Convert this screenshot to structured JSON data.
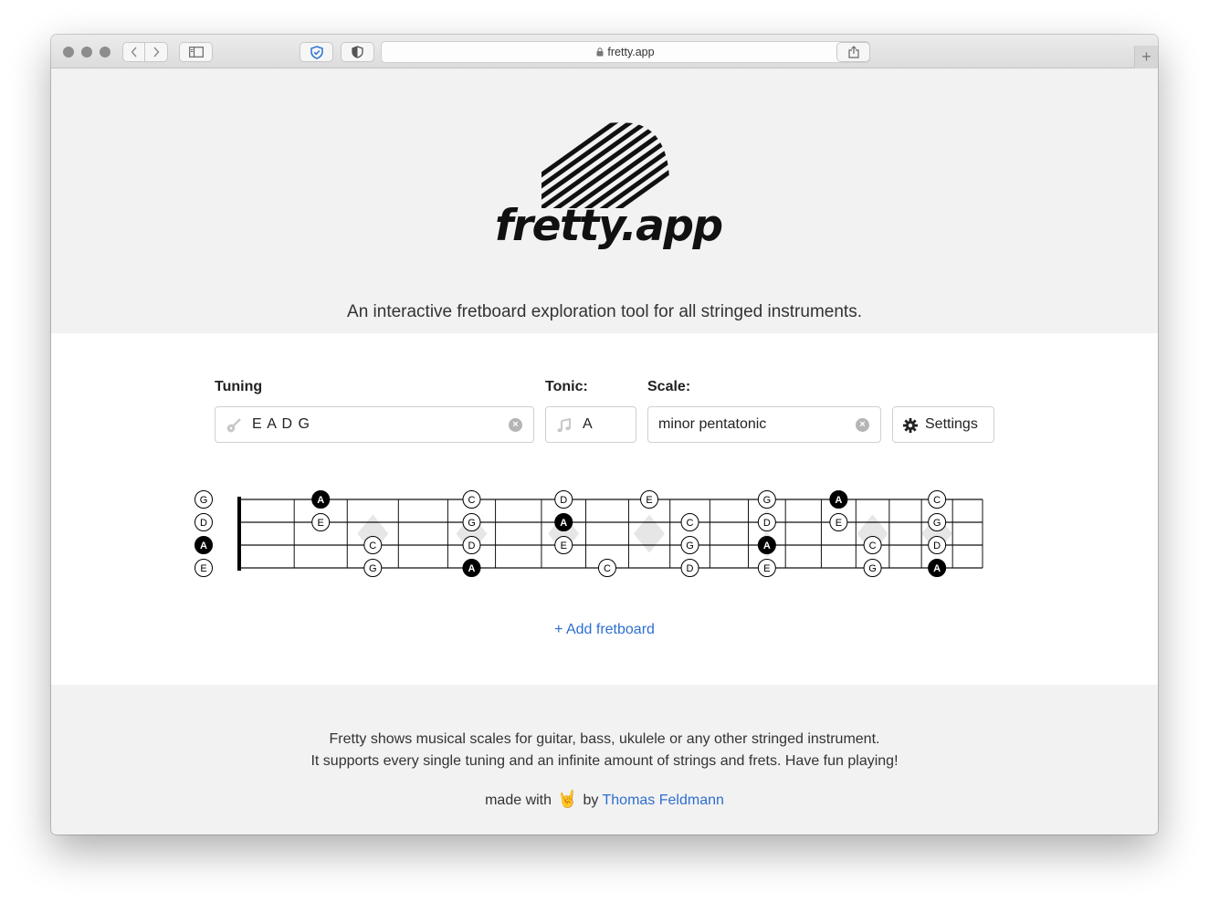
{
  "browser": {
    "url": "fretty.app"
  },
  "hero": {
    "logo_text": "fretty.app",
    "tagline": "An interactive fretboard exploration tool for all stringed instruments."
  },
  "controls": {
    "tuning_label": "Tuning",
    "tuning_value": "E A D G",
    "tonic_label": "Tonic:",
    "tonic_value": "A",
    "scale_label": "Scale:",
    "scale_value": "minor pentatonic",
    "settings_label": "Settings"
  },
  "fretboard": {
    "open_strings": [
      "G",
      "D",
      "A",
      "E"
    ],
    "tonic": "A",
    "notes": [
      {
        "string": 0,
        "fret": 2,
        "note": "A"
      },
      {
        "string": 0,
        "fret": 5,
        "note": "C"
      },
      {
        "string": 0,
        "fret": 7,
        "note": "D"
      },
      {
        "string": 0,
        "fret": 9,
        "note": "E"
      },
      {
        "string": 0,
        "fret": 12,
        "note": "G"
      },
      {
        "string": 0,
        "fret": 14,
        "note": "A"
      },
      {
        "string": 0,
        "fret": 17,
        "note": "C"
      },
      {
        "string": 1,
        "fret": 2,
        "note": "E"
      },
      {
        "string": 1,
        "fret": 5,
        "note": "G"
      },
      {
        "string": 1,
        "fret": 7,
        "note": "A"
      },
      {
        "string": 1,
        "fret": 10,
        "note": "C"
      },
      {
        "string": 1,
        "fret": 12,
        "note": "D"
      },
      {
        "string": 1,
        "fret": 14,
        "note": "E"
      },
      {
        "string": 1,
        "fret": 17,
        "note": "G"
      },
      {
        "string": 2,
        "fret": 3,
        "note": "C"
      },
      {
        "string": 2,
        "fret": 5,
        "note": "D"
      },
      {
        "string": 2,
        "fret": 7,
        "note": "E"
      },
      {
        "string": 2,
        "fret": 10,
        "note": "G"
      },
      {
        "string": 2,
        "fret": 12,
        "note": "A"
      },
      {
        "string": 2,
        "fret": 15,
        "note": "C"
      },
      {
        "string": 2,
        "fret": 17,
        "note": "D"
      },
      {
        "string": 3,
        "fret": 3,
        "note": "G"
      },
      {
        "string": 3,
        "fret": 5,
        "note": "A"
      },
      {
        "string": 3,
        "fret": 8,
        "note": "C"
      },
      {
        "string": 3,
        "fret": 10,
        "note": "D"
      },
      {
        "string": 3,
        "fret": 12,
        "note": "E"
      },
      {
        "string": 3,
        "fret": 15,
        "note": "G"
      },
      {
        "string": 3,
        "fret": 17,
        "note": "A"
      }
    ]
  },
  "add_fretboard_label": "+ Add fretboard",
  "footer": {
    "line1": "Fretty shows musical scales for guitar, bass, ukulele or any other stringed instrument.",
    "line2": "It supports every single tuning and an infinite amount of strings and frets. Have fun playing!",
    "made_with": "made with",
    "emoji": "🤘",
    "by": "by",
    "author": "Thomas Feldmann"
  },
  "colors": {
    "link": "#2d6fd0",
    "hero_bg": "#f2f2f2",
    "tonic_fill": "#000000"
  }
}
